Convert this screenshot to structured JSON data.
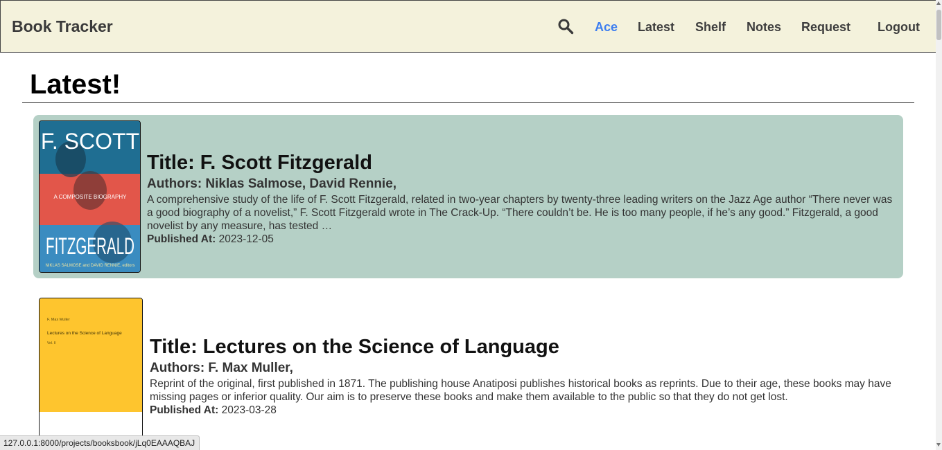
{
  "navbar": {
    "brand": "Book Tracker",
    "links": [
      {
        "label": "Ace",
        "active": true
      },
      {
        "label": "Latest",
        "active": false
      },
      {
        "label": "Shelf",
        "active": false
      },
      {
        "label": "Notes",
        "active": false
      },
      {
        "label": "Request",
        "active": false
      },
      {
        "label": "Logout",
        "active": false
      }
    ],
    "search_icon": "search-icon",
    "active_color": "#3d7ef0"
  },
  "page": {
    "title": "Latest!"
  },
  "books": [
    {
      "title": "Title: F. Scott Fitzgerald",
      "authors": "Authors: Niklas Salmose, David Rennie,",
      "description": "A comprehensive study of the life of F. Scott Fitzgerald, related in two-year chapters by twenty-three leading writers on the Jazz Age author “There never was a good biography of a novelist,” F. Scott Fitzgerald wrote in The Crack-Up. “There couldn’t be. He is too many people, if he’s any good.” Fitzgerald, a good novelist by any measure, has tested …",
      "published_label": "Published At:",
      "published_date": "2023-12-05",
      "cover": {
        "top_text": "F. SCOTT",
        "middle_text": "A COMPOSITE BIOGRAPHY",
        "bottom_text": "FITZGERALD",
        "credit_text": "NIKLAS SALMOSE and DAVID RENNIE, editors"
      },
      "highlighted": true,
      "highlight_color": "#b5d0c6"
    },
    {
      "title": "Title: Lectures on the Science of Language",
      "authors": "Authors: F. Max Muller,",
      "description": "Reprint of the original, first published in 1871. The publishing house Anatiposi publishes historical books as reprints. Due to their age, these books may have missing pages or inferior quality. Our aim is to preserve these books and make them available to the public so that they do not get lost.",
      "published_label": "Published At:",
      "published_date": "2023-03-28",
      "cover": {
        "author_text": "F. Max Muller",
        "title_text": "Lectures on the Science of Language",
        "volume_text": "Vol. II"
      },
      "highlighted": false
    }
  ],
  "status_bar": {
    "url": "127.0.0.1:8000/projects/booksbook/jLq0EAAAQBAJ"
  }
}
